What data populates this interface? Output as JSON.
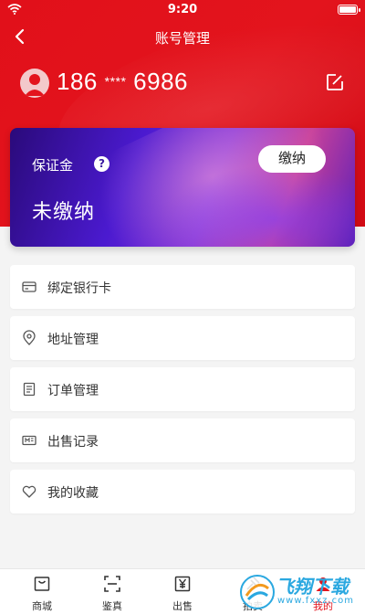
{
  "status_bar": {
    "time": "9:20"
  },
  "nav": {
    "title": "账号管理"
  },
  "user": {
    "phone_prefix": "186",
    "phone_mask": "****",
    "phone_suffix": "6986"
  },
  "deposit": {
    "label": "保证金",
    "help": "?",
    "status": "未缴纳",
    "pay_label": "缴纳"
  },
  "menu": {
    "items": [
      {
        "label": "绑定银行卡",
        "icon": "card-icon"
      },
      {
        "label": "地址管理",
        "icon": "location-pin-icon"
      },
      {
        "label": "订单管理",
        "icon": "order-list-icon"
      },
      {
        "label": "出售记录",
        "icon": "record-icon"
      },
      {
        "label": "我的收藏",
        "icon": "heart-icon"
      }
    ]
  },
  "tabs": [
    {
      "label": "商城",
      "icon": "shop-icon"
    },
    {
      "label": "鉴真",
      "icon": "scan-icon"
    },
    {
      "label": "出售",
      "icon": "yen-icon"
    },
    {
      "label": "拍卖",
      "icon": "auction-icon"
    },
    {
      "label": "我的",
      "icon": "profile-icon",
      "active": true
    }
  ],
  "watermark": {
    "title": "飞翔下载",
    "sub": "www.fxxz.com"
  },
  "colors": {
    "brand_red": "#e3141d",
    "card_purple": "#4b1ad0"
  }
}
